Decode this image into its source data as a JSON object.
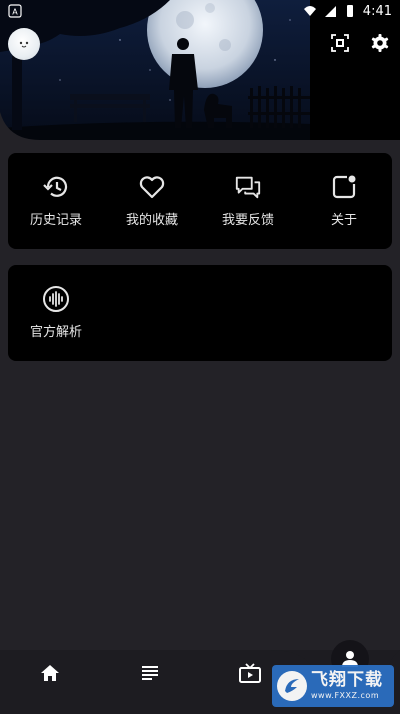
{
  "status_bar": {
    "time": "4:41"
  },
  "header": {
    "avatar_icon": "cloud-avatar-icon",
    "scan_icon": "scan-qr-icon",
    "settings_icon": "gear-icon"
  },
  "menu_card": {
    "items": [
      {
        "label": "历史记录",
        "icon": "history-icon"
      },
      {
        "label": "我的收藏",
        "icon": "heart-icon"
      },
      {
        "label": "我要反馈",
        "icon": "feedback-icon"
      },
      {
        "label": "关于",
        "icon": "about-icon"
      }
    ]
  },
  "parse_card": {
    "items": [
      {
        "label": "官方解析",
        "icon": "audio-wave-icon"
      }
    ]
  },
  "bottom_nav": {
    "items": [
      {
        "icon": "home-icon"
      },
      {
        "icon": "list-icon"
      },
      {
        "icon": "tv-icon"
      },
      {
        "icon": "person-icon"
      }
    ]
  },
  "watermark": {
    "title": "飞翔下载",
    "url": "www.FXXZ.com"
  },
  "colors": {
    "background": "#232227",
    "card": "#000000",
    "text": "#e6e6e6"
  }
}
